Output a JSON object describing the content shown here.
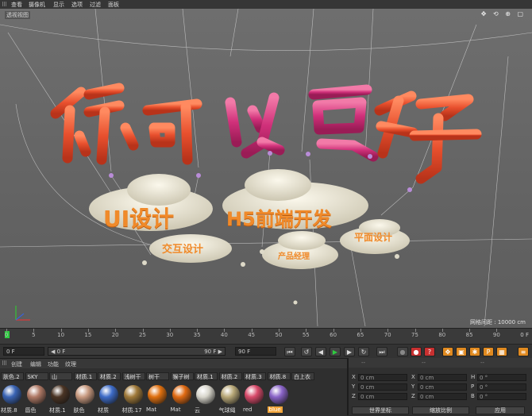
{
  "menu": [
    "查看",
    "摄像机",
    "显示",
    "选项",
    "过滤",
    "面板"
  ],
  "viewport": {
    "label": "透视视图",
    "grid_readout": "网格间距 : 10000 cm",
    "title_3d": [
      "你",
      "可",
      "以",
      "更",
      "好"
    ],
    "clouds": [
      "UI设计",
      "H5前端开发",
      "交互设计",
      "产品经理",
      "平面设计"
    ],
    "colors": {
      "balloon_red": "#e8502e",
      "balloon_pink": "#d0307a",
      "cloud": "#e8e4d4",
      "cloud_text": "#f08a2a"
    }
  },
  "timeline": {
    "ticks": [
      "0",
      "5",
      "10",
      "15",
      "20",
      "25",
      "30",
      "35",
      "40",
      "45",
      "50",
      "55",
      "60",
      "65",
      "70",
      "75",
      "80",
      "85",
      "90"
    ],
    "frame_readout": "0 F"
  },
  "transport": {
    "start_field": "0 F",
    "range_start": "◀ 0 F",
    "range_end": "90 F ▶",
    "end_field": "90 F"
  },
  "materials": {
    "menu": [
      "创建",
      "编辑",
      "功能",
      "纹理"
    ],
    "top_row": [
      "肤色.2",
      "SKY",
      "山",
      "材质.1",
      "材质.2",
      "浅树干",
      "树干",
      "猴子树",
      "材质.1",
      "材质.2",
      "材质.3",
      "材质.8",
      "白上衣"
    ],
    "swatches": [
      {
        "name": "材质.8",
        "color": "#3a64b4"
      },
      {
        "name": "唇色",
        "color": "#b07a66"
      },
      {
        "name": "材质.1",
        "color": "#4a3424"
      },
      {
        "name": "肤色",
        "color": "#c89a80"
      },
      {
        "name": "材质",
        "color": "#3e6cc8"
      },
      {
        "name": "材质.17",
        "color": "#a07a3a"
      },
      {
        "name": "Mat",
        "color": "#e0700f"
      },
      {
        "name": "Mat",
        "color": "#e06a12"
      },
      {
        "name": "云",
        "color": "#d8d6cc"
      },
      {
        "name": "气球绳",
        "color": "#b8a878"
      },
      {
        "name": "red",
        "color": "#d84a6a"
      },
      {
        "name": "blue",
        "color": "#8a64c8"
      }
    ],
    "selected_index": 11
  },
  "attributes": {
    "rows": [
      {
        "a": "X",
        "av": "0 cm",
        "b": "X",
        "bv": "0 cm",
        "c": "H",
        "cv": "0 °"
      },
      {
        "a": "Y",
        "av": "0 cm",
        "b": "Y",
        "bv": "0 cm",
        "c": "P",
        "cv": "0 °"
      },
      {
        "a": "Z",
        "av": "0 cm",
        "b": "Z",
        "bv": "0 cm",
        "c": "B",
        "cv": "0 °"
      }
    ],
    "coord_select": "世界坐标",
    "scale_select": "缩放比例",
    "apply": "应用"
  }
}
